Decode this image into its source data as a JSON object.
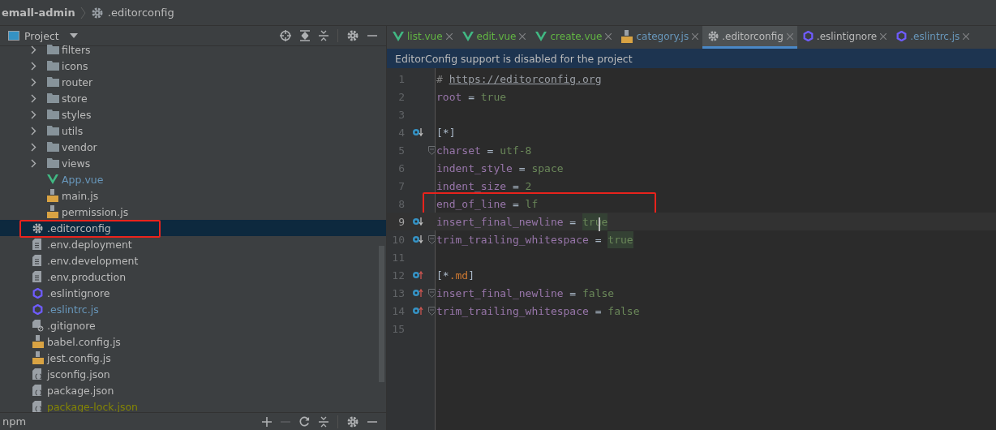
{
  "breadcrumb": {
    "project": "emall-admin",
    "file": ".editorconfig"
  },
  "project_panel": {
    "title": "Project",
    "tree": [
      {
        "children": [
          {
            "label": "filters",
            "kind": "folder",
            "modified": false,
            "ignored": false,
            "selected": false,
            "annotated": false
          },
          {
            "label": "icons",
            "kind": "folder",
            "modified": false,
            "ignored": false,
            "selected": false,
            "annotated": false
          },
          {
            "label": "router",
            "kind": "folder",
            "modified": false,
            "ignored": false,
            "selected": false,
            "annotated": false
          },
          {
            "label": "store",
            "kind": "folder",
            "modified": false,
            "ignored": false,
            "selected": false,
            "annotated": false
          },
          {
            "label": "styles",
            "kind": "folder",
            "modified": false,
            "ignored": false,
            "selected": false,
            "annotated": false
          },
          {
            "label": "utils",
            "kind": "folder",
            "modified": false,
            "ignored": false,
            "selected": false,
            "annotated": false
          },
          {
            "label": "vendor",
            "kind": "folder",
            "modified": false,
            "ignored": false,
            "selected": false,
            "annotated": false
          },
          {
            "label": "views",
            "kind": "folder",
            "modified": false,
            "ignored": false,
            "selected": false,
            "annotated": false
          },
          {
            "label": "App.vue",
            "kind": "vue",
            "modified": true,
            "ignored": false,
            "selected": false,
            "annotated": false
          },
          {
            "label": "main.js",
            "kind": "js",
            "modified": false,
            "ignored": false,
            "selected": false,
            "annotated": false
          },
          {
            "label": "permission.js",
            "kind": "js",
            "modified": false,
            "ignored": false,
            "selected": false,
            "annotated": false
          }
        ]
      },
      {
        "label": ".editorconfig",
        "kind": "config",
        "modified": false,
        "ignored": false,
        "selected": true,
        "annotated": true
      },
      {
        "label": ".env.deployment",
        "kind": "text",
        "modified": false,
        "ignored": false,
        "selected": false,
        "annotated": false
      },
      {
        "label": ".env.development",
        "kind": "text",
        "modified": false,
        "ignored": false,
        "selected": false,
        "annotated": false
      },
      {
        "label": ".env.production",
        "kind": "text",
        "modified": false,
        "ignored": false,
        "selected": false,
        "annotated": false
      },
      {
        "label": ".eslintignore",
        "kind": "eslint",
        "modified": false,
        "ignored": false,
        "selected": false,
        "annotated": false
      },
      {
        "label": ".eslintrc.js",
        "kind": "eslint",
        "modified": true,
        "ignored": false,
        "selected": false,
        "annotated": false
      },
      {
        "label": ".gitignore",
        "kind": "gitignore",
        "modified": false,
        "ignored": false,
        "selected": false,
        "annotated": false
      },
      {
        "label": "babel.config.js",
        "kind": "js",
        "modified": false,
        "ignored": false,
        "selected": false,
        "annotated": false
      },
      {
        "label": "jest.config.js",
        "kind": "js",
        "modified": false,
        "ignored": false,
        "selected": false,
        "annotated": false
      },
      {
        "label": "jsconfig.json",
        "kind": "json",
        "modified": false,
        "ignored": false,
        "selected": false,
        "annotated": false
      },
      {
        "label": "package.json",
        "kind": "json",
        "modified": false,
        "ignored": false,
        "selected": false,
        "annotated": false
      },
      {
        "label": "package-lock.json",
        "kind": "json",
        "modified": false,
        "ignored": true,
        "selected": false,
        "annotated": false
      }
    ]
  },
  "npm_panel": {
    "title": "npm"
  },
  "tabs": [
    {
      "label": "list.vue",
      "kind": "vue",
      "added": true,
      "modified": false,
      "selected": false
    },
    {
      "label": "edit.vue",
      "kind": "vue",
      "added": true,
      "modified": false,
      "selected": false
    },
    {
      "label": "create.vue",
      "kind": "vue",
      "added": true,
      "modified": false,
      "selected": false
    },
    {
      "label": "category.js",
      "kind": "js",
      "added": false,
      "modified": true,
      "selected": false
    },
    {
      "label": ".editorconfig",
      "kind": "config",
      "added": false,
      "modified": false,
      "selected": true
    },
    {
      "label": ".eslintignore",
      "kind": "eslint",
      "added": false,
      "modified": false,
      "selected": false
    },
    {
      "label": ".eslintrc.js",
      "kind": "eslint",
      "added": false,
      "modified": true,
      "selected": false
    }
  ],
  "banner": "EditorConfig support is disabled for the project",
  "code_lines": [
    {
      "number": "1",
      "overridden_below": false,
      "overrides_above": false,
      "fold": false,
      "current": false,
      "annotated": false,
      "tokens": [
        {
          "kind": "comment",
          "text": "# "
        },
        {
          "kind": "link",
          "text": "https://editorconfig.org"
        }
      ]
    },
    {
      "number": "2",
      "overridden_below": false,
      "overrides_above": false,
      "fold": false,
      "current": false,
      "annotated": false,
      "tokens": [
        {
          "kind": "key",
          "text": "root"
        },
        {
          "kind": "op",
          "text": " = "
        },
        {
          "kind": "value",
          "text": "true"
        }
      ]
    },
    {
      "number": "3",
      "overridden_below": false,
      "overrides_above": false,
      "fold": false,
      "current": false,
      "annotated": false
    },
    {
      "number": "4",
      "overridden_below": true,
      "overrides_above": false,
      "fold": false,
      "current": false,
      "annotated": false,
      "tokens": [
        {
          "kind": "section",
          "text": "[*]"
        }
      ]
    },
    {
      "number": "5",
      "overridden_below": false,
      "overrides_above": false,
      "fold": true,
      "current": false,
      "annotated": false,
      "tokens": [
        {
          "kind": "key",
          "text": "charset"
        },
        {
          "kind": "op",
          "text": " = "
        },
        {
          "kind": "value",
          "text": "utf-8"
        }
      ]
    },
    {
      "number": "6",
      "overridden_below": false,
      "overrides_above": false,
      "fold": false,
      "current": false,
      "annotated": false,
      "tokens": [
        {
          "kind": "key",
          "text": "indent_style"
        },
        {
          "kind": "op",
          "text": " = "
        },
        {
          "kind": "value",
          "text": "space"
        }
      ]
    },
    {
      "number": "7",
      "overridden_below": false,
      "overrides_above": false,
      "fold": false,
      "current": false,
      "annotated": false,
      "tokens": [
        {
          "kind": "key",
          "text": "indent_size"
        },
        {
          "kind": "op",
          "text": " = "
        },
        {
          "kind": "value",
          "text": "2"
        }
      ]
    },
    {
      "number": "8",
      "overridden_below": false,
      "overrides_above": false,
      "fold": false,
      "current": false,
      "annotated": true,
      "tokens": [
        {
          "kind": "key",
          "text": "end_of_line"
        },
        {
          "kind": "op",
          "text": " = "
        },
        {
          "kind": "value",
          "text": "lf"
        }
      ]
    },
    {
      "number": "9",
      "overridden_below": true,
      "overrides_above": false,
      "fold": false,
      "current": true,
      "annotated": false,
      "tokens": [
        {
          "kind": "key",
          "text": "insert_final_newline"
        },
        {
          "kind": "op",
          "text": " = "
        },
        {
          "kind": "value-hl",
          "text": "true"
        }
      ]
    },
    {
      "number": "10",
      "overridden_below": true,
      "overrides_above": false,
      "fold": true,
      "current": false,
      "annotated": false,
      "tokens": [
        {
          "kind": "key",
          "text": "trim_trailing_whitespace"
        },
        {
          "kind": "op",
          "text": " = "
        },
        {
          "kind": "value-hl",
          "text": "true"
        }
      ]
    },
    {
      "number": "11",
      "overridden_below": false,
      "overrides_above": false,
      "fold": false,
      "current": false,
      "annotated": false
    },
    {
      "number": "12",
      "overridden_below": false,
      "overrides_above": true,
      "fold": false,
      "current": false,
      "annotated": false,
      "tokens": [
        {
          "kind": "section",
          "text": "[*"
        },
        {
          "kind": "ext",
          "text": ".md"
        },
        {
          "kind": "section",
          "text": "]"
        }
      ]
    },
    {
      "number": "13",
      "overridden_below": false,
      "overrides_above": true,
      "fold": true,
      "current": false,
      "annotated": false,
      "tokens": [
        {
          "kind": "key",
          "text": "insert_final_newline"
        },
        {
          "kind": "op",
          "text": " = "
        },
        {
          "kind": "value",
          "text": "false"
        }
      ]
    },
    {
      "number": "14",
      "overridden_below": false,
      "overrides_above": true,
      "fold": true,
      "current": false,
      "annotated": false,
      "tokens": [
        {
          "kind": "key",
          "text": "trim_trailing_whitespace"
        },
        {
          "kind": "op",
          "text": " = "
        },
        {
          "kind": "value",
          "text": "false"
        }
      ]
    },
    {
      "number": "15",
      "overridden_below": false,
      "overrides_above": false,
      "fold": false,
      "current": false,
      "annotated": false
    }
  ]
}
